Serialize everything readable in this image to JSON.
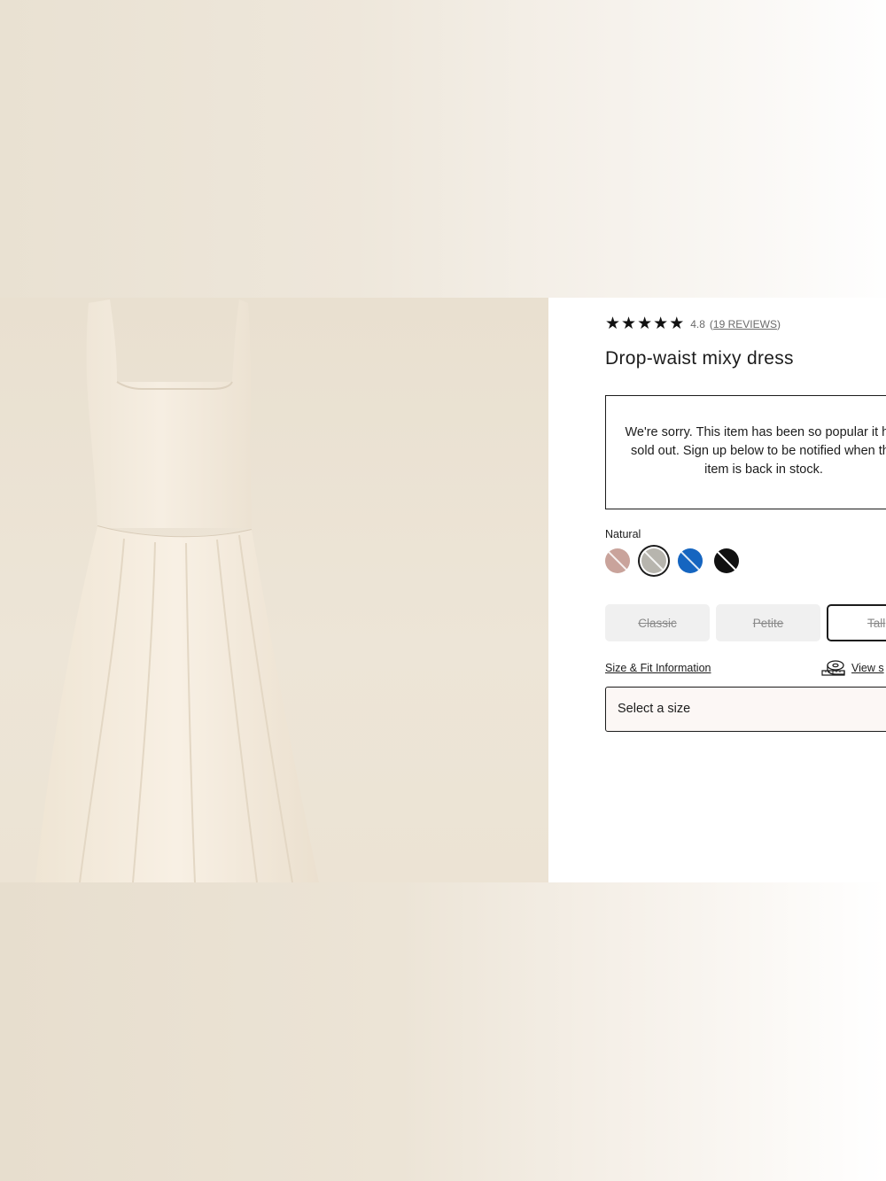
{
  "product": {
    "rating": {
      "stars": 5,
      "value": "4.8",
      "reviews_link": "19 REVIEWS",
      "open_paren": "(",
      "close_paren": ")"
    },
    "title": "Drop-waist mixy dress",
    "sold_out_message": "We're sorry. This item has been so popular it has sold out. Sign up below to be notified when the item is back in stock.",
    "color": {
      "selected_label": "Natural",
      "swatches": [
        {
          "name": "rose",
          "hex": "#c9a39b",
          "selected": false
        },
        {
          "name": "natural",
          "hex": "#b7b5ae",
          "selected": true
        },
        {
          "name": "blue",
          "hex": "#1565c0",
          "selected": false
        },
        {
          "name": "black",
          "hex": "#111111",
          "selected": false
        }
      ]
    },
    "fit_options": [
      "Classic",
      "Petite",
      "Tall"
    ],
    "size_fit_link": "Size & Fit Information",
    "view_size_link": "View s",
    "size_select_placeholder": "Select a size"
  },
  "image": {
    "alt": "Drop-waist mixy dress in natural",
    "dress_color": "#f4ece0",
    "background_color": "#ebe2d3"
  }
}
